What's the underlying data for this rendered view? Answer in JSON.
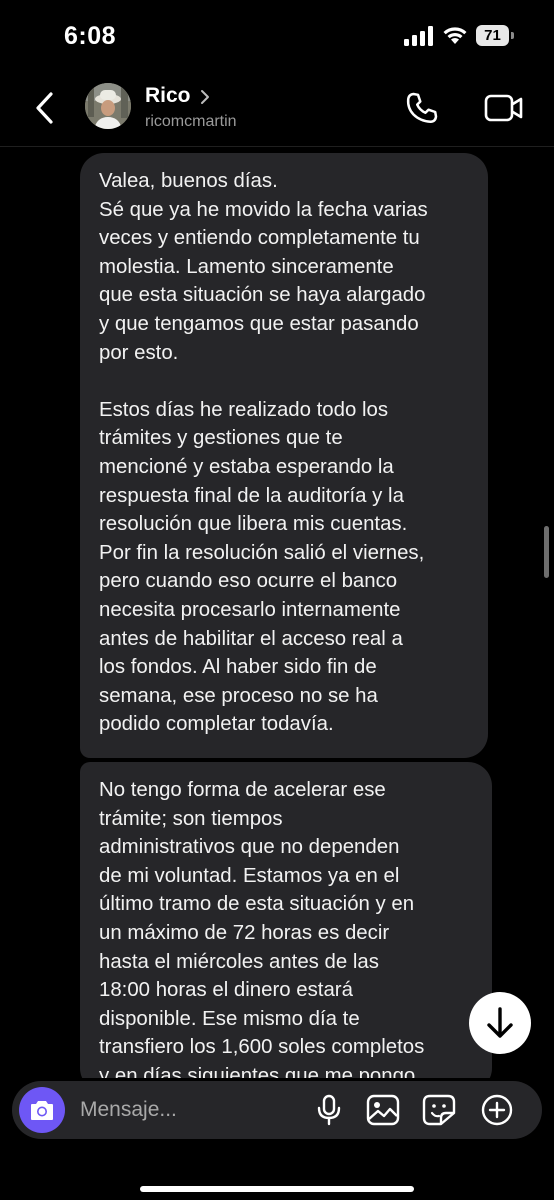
{
  "status_bar": {
    "time": "6:08",
    "battery_level": "71"
  },
  "header": {
    "contact_name": "Rico",
    "username": "ricomcmartin"
  },
  "messages": [
    {
      "paragraphs": [
        "Valea, buenos días.\nSé que ya he movido la fecha varias\nveces y entiendo completamente tu\nmolestia. Lamento sinceramente\nque esta situación se haya alargado\ny que tengamos que estar pasando\npor esto.",
        "Estos días he realizado todo los\ntrámites y gestiones que te\nmencioné y estaba esperando la\nrespuesta final de la auditoría y la\nresolución que libera mis cuentas.\nPor fin la resolución salió el viernes,\npero cuando eso ocurre el banco\nnecesita procesarlo internamente\nantes de habilitar el acceso real a\nlos fondos. Al haber sido fin de\nsemana, ese proceso no se ha\npodido completar todavía."
      ]
    },
    {
      "paragraphs": [
        "No tengo forma de acelerar ese\ntrámite; son tiempos\nadministrativos que no dependen\nde mi voluntad. Estamos ya en el\núltimo tramo de esta situación y en\nun máximo de 72 horas es decir\nhasta el miércoles antes de las\n18:00 horas el dinero estará\ndisponible. Ese mismo día te\ntransfiero los 1,600 soles completos\ny en días siguientes que me pongo"
      ]
    }
  ],
  "composer": {
    "placeholder": "Mensaje..."
  },
  "icons": {
    "back": "chevron-left-icon",
    "call": "phone-icon",
    "video": "video-camera-icon",
    "camera": "camera-icon",
    "mic": "microphone-icon",
    "gallery": "image-icon",
    "sticker": "sticker-icon",
    "plus": "plus-circle-icon",
    "scroll_down": "arrow-down-icon"
  },
  "colors": {
    "background": "#000000",
    "bubble": "#262629",
    "camera_button": "#6e57f5",
    "secondary_text": "#9a9a9a"
  }
}
